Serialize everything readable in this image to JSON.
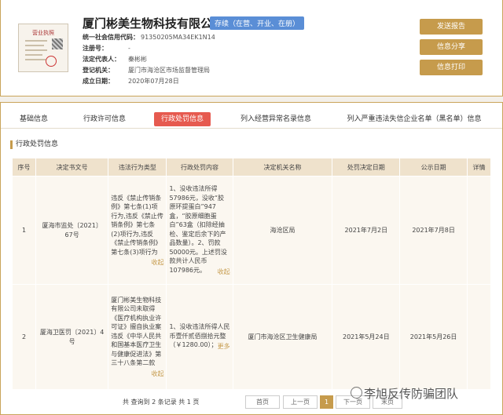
{
  "header": {
    "company_name": "厦门彬美生物科技有限公司",
    "status": "存续（在营、开业、在册）",
    "license_title": "营业执照",
    "fields": [
      {
        "key": "统一社会信用代码：",
        "value": "91350205MA34EK1N14"
      },
      {
        "key": "注册号：",
        "value": "-"
      },
      {
        "key": "法定代表人：",
        "value": "秦彬彬"
      },
      {
        "key": "登记机关：",
        "value": "厦门市海沧区市场监督管理局"
      },
      {
        "key": "成立日期：",
        "value": "2020年07月28日"
      }
    ],
    "buttons": {
      "report": "发送报告",
      "share": "信息分享",
      "print": "信息打印"
    }
  },
  "tabs": [
    "基础信息",
    "行政许可信息",
    "行政处罚信息",
    "列入经营异常名录信息",
    "列入严重违法失信企业名单（黑名单）信息"
  ],
  "active_tab": "行政处罚信息",
  "section_title": "行政处罚信息",
  "table": {
    "headers": [
      "序号",
      "决定书文号",
      "违法行为类型",
      "行政处罚内容",
      "决定机关名称",
      "处罚决定日期",
      "公示日期",
      "详情"
    ],
    "rows": [
      {
        "no": "1",
        "doc": "厦海市监处〔2021〕67号",
        "type": "违反《禁止传销条例》第七条(1)项行为,违反《禁止传销条例》第七条(2)项行为,违反《禁止传销条例》第七条(3)项行为",
        "type_fold": "收起",
        "content": "1、没收违法所得57986元，没收“胶原环提蛋白”947盒，“胶原细胞蛋白”63盒（扣除经抽检、鉴定后余下的产品数量）。2、罚款50000元。上述罚没款共计人民币107986元。",
        "content_fold": "收起",
        "authority": "海沧区局",
        "decision_date": "2021年7月2日",
        "publish_date": "2021年7月8日",
        "detail": ""
      },
      {
        "no": "2",
        "doc": "厦海卫医罚〔2021〕4号",
        "type": "厦门彬美生物科技有限公司未取得《医疗机构执业许可证》擅自执业案违反《中华人民共和国基本医疗卫生与健康促进法》第三十八条第二款",
        "type_fold": "收起",
        "content": "1、没收违法所得人民币壹仟贰佰捌拾元整（￥1280.00）；",
        "content_fold": "更多",
        "authority": "厦门市海沧区卫生健康局",
        "decision_date": "2021年5月24日",
        "publish_date": "2021年5月26日",
        "detail": ""
      }
    ]
  },
  "pagination": {
    "summary": "共 查询到 2 条记录 共 1 页",
    "first": "首页",
    "prev": "上一页",
    "current": "1",
    "next": "下一页",
    "last": "末页"
  },
  "watermark": "李旭反传防骗团队",
  "colors": {
    "gold": "#c69b4c",
    "active_tab": "#e65a4f",
    "status_tag": "#5a8ed6",
    "header_row": "#efe2cc"
  }
}
